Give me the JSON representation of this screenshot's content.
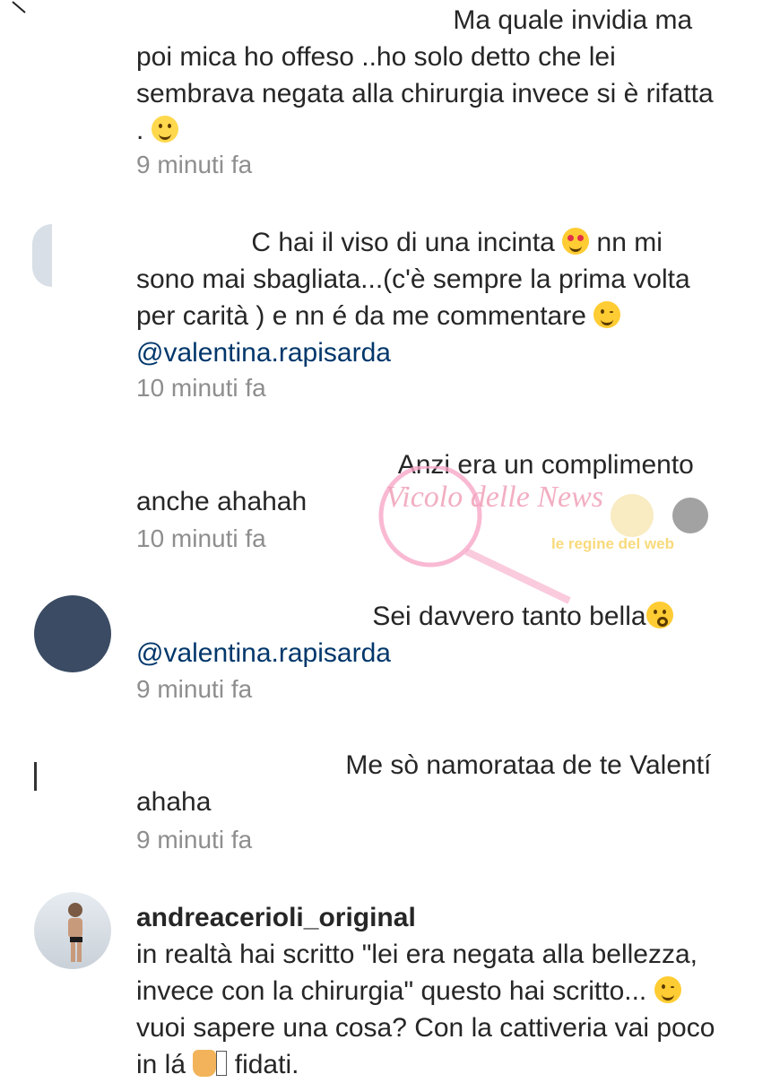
{
  "comments": [
    {
      "id": "c1",
      "author_hidden": true,
      "text": "Ma quale invidia ma poi mica ho offeso ..ho solo detto che lei sembrava negata alla chirurgia invece si è rifatta .",
      "emoji": "laughing",
      "time": "9 minuti fa"
    },
    {
      "id": "c2",
      "author_hidden": true,
      "text_before": "C hai il viso di una incinta",
      "emoji1": "heart-eyes",
      "text_middle": "nn mi sono mai  sbagliata...(c'è sempre la prima volta per carità )  e nn é da me commentare",
      "emoji2": "winking",
      "mention": "@valentina.rapisarda",
      "time": "10 minuti fa"
    },
    {
      "id": "c3",
      "author_hidden": true,
      "text": "Anzi era un complimento anche ahahah",
      "time": "10 minuti fa"
    },
    {
      "id": "c4",
      "author_hidden": true,
      "text": "Sei davvero tanto bella",
      "emoji": "kiss",
      "mention": "@valentina.rapisarda",
      "time": "9 minuti fa"
    },
    {
      "id": "c5",
      "author_hidden": true,
      "text": "Me sò namorataa de te Valentí ahaha",
      "time": "9 minuti fa"
    },
    {
      "id": "c6",
      "author": "andreacerioli_original",
      "text_before": "in realtà hai scritto \"lei era negata alla bellezza, invece con la chirurgia\" questo hai scritto...",
      "emoji1": "winking",
      "text_after": "vuoi sapere una cosa? Con la cattiveria vai poco in lá",
      "emoji2": "thumbs-up",
      "text_end": "fidati."
    }
  ],
  "watermark": {
    "left_text": "Vicolo delle News",
    "right_text": "le regine del web"
  },
  "colors": {
    "text": "#262626",
    "timestamp": "#8e8e8e",
    "mention": "#00376b",
    "watermark_pink": "#f7a8c8"
  }
}
